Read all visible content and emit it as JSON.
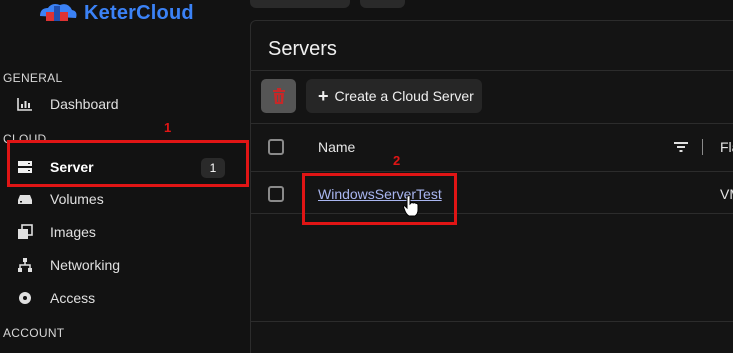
{
  "brand": {
    "name": "KeterCloud",
    "accent": "#3b82f6"
  },
  "sidebar": {
    "sections": {
      "general": "GENERAL",
      "cloud": "CLOUD",
      "account": "ACCOUNT"
    },
    "items": [
      {
        "label": "Dashboard",
        "icon": "bar-chart-icon"
      },
      {
        "label": "Server",
        "icon": "server-icon",
        "active": true,
        "badge": "1"
      },
      {
        "label": "Volumes",
        "icon": "drive-icon"
      },
      {
        "label": "Images",
        "icon": "images-icon"
      },
      {
        "label": "Networking",
        "icon": "network-icon"
      },
      {
        "label": "Access",
        "icon": "access-disc-icon"
      }
    ]
  },
  "main": {
    "title": "Servers",
    "toolbar": {
      "delete_icon": "trash-icon",
      "create_label": "Create a Cloud Server"
    },
    "table": {
      "columns": [
        "Name",
        "Fla"
      ],
      "rows": [
        {
          "name": "WindowsServerTest",
          "flavor": "VM"
        }
      ]
    }
  },
  "annotations": {
    "step1": "1",
    "step2": "2",
    "color": "#e01515"
  }
}
